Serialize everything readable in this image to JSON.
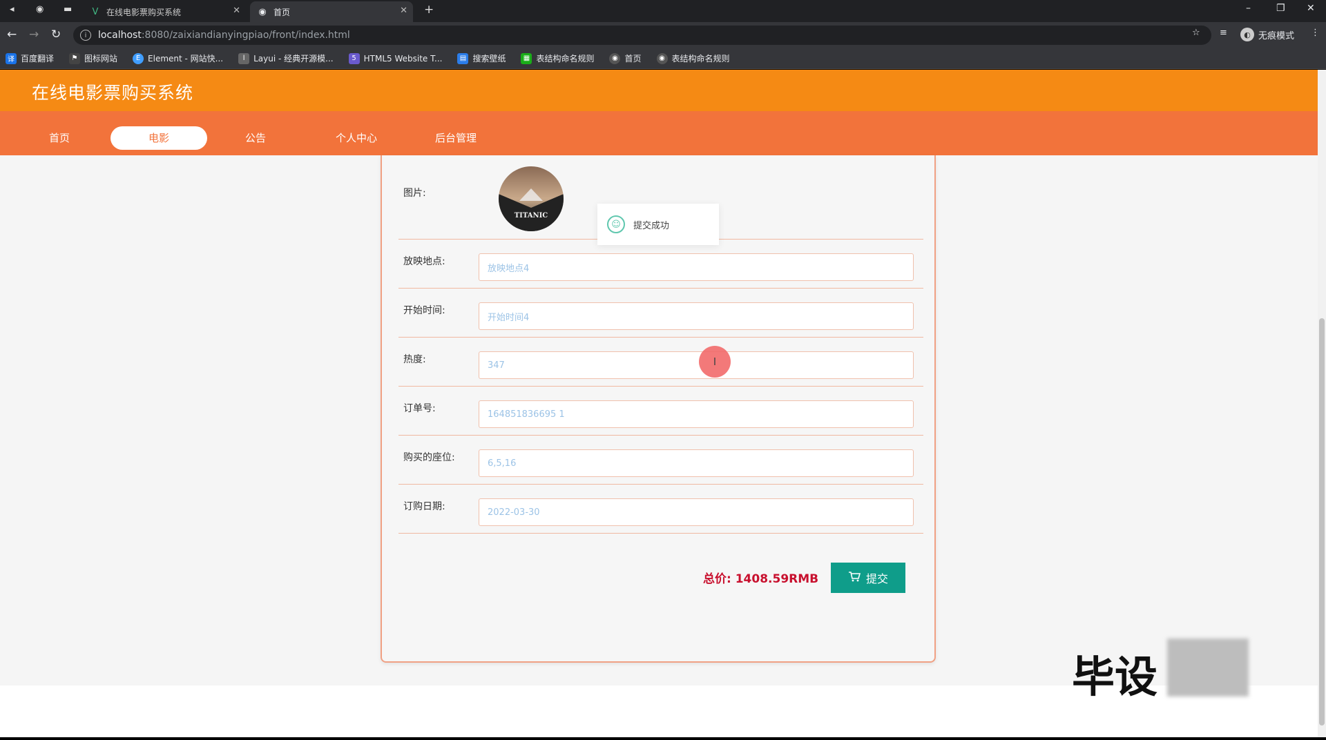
{
  "browser": {
    "tabs": [
      {
        "title": "在线电影票购买系统",
        "active": false
      },
      {
        "title": "首页",
        "active": true
      }
    ],
    "url_host": "localhost",
    "url_path": ":8080/zaixiandianyingpiao/front/index.html",
    "profile_label": "无痕模式",
    "bookmarks": [
      {
        "label": "百度翻译",
        "icon": "translate-icon",
        "color": "#1a73e8"
      },
      {
        "label": "图标网站",
        "icon": "flag-icon",
        "color": "#444"
      },
      {
        "label": "Element - 网站快...",
        "icon": "element-icon",
        "color": "#409eff"
      },
      {
        "label": "Layui - 经典开源模...",
        "icon": "layui-icon",
        "color": "#666"
      },
      {
        "label": "HTML5 Website T...",
        "icon": "html5-icon",
        "color": "#6a5acd"
      },
      {
        "label": "搜索壁纸",
        "icon": "wallpaper-icon",
        "color": "#2b7de9"
      },
      {
        "label": "表结构命名规则",
        "icon": "table-icon",
        "color": "#1aad19"
      },
      {
        "label": "首页",
        "icon": "globe-icon",
        "color": "#555"
      },
      {
        "label": "表结构命名规则",
        "icon": "globe-icon",
        "color": "#555"
      }
    ]
  },
  "site": {
    "title": "在线电影票购买系统",
    "nav": [
      {
        "label": "首页",
        "active": false
      },
      {
        "label": "电影",
        "active": true
      },
      {
        "label": "公告",
        "active": false
      },
      {
        "label": "个人中心",
        "active": false
      },
      {
        "label": "后台管理",
        "active": false
      }
    ],
    "accent_header": "#f58a14",
    "accent_nav": "#f2733b"
  },
  "form": {
    "picture_label": "图片:",
    "poster_text": "TITANIC",
    "fields": [
      {
        "label": "放映地点:",
        "value": "放映地点4"
      },
      {
        "label": "开始时间:",
        "value": "开始时间4"
      },
      {
        "label": "热度:",
        "value": "347"
      },
      {
        "label": "订单号:",
        "value": "164851836695 1"
      },
      {
        "label": "购买的座位:",
        "value": "6,5,16"
      },
      {
        "label": "订购日期:",
        "value": "2022-03-30"
      }
    ],
    "total_text": "总价: 1408.59RMB",
    "submit_label": "提交",
    "submit_color": "#0f9d8a"
  },
  "toast": {
    "message": "提交成功"
  },
  "watermark": {
    "text": "毕设"
  }
}
